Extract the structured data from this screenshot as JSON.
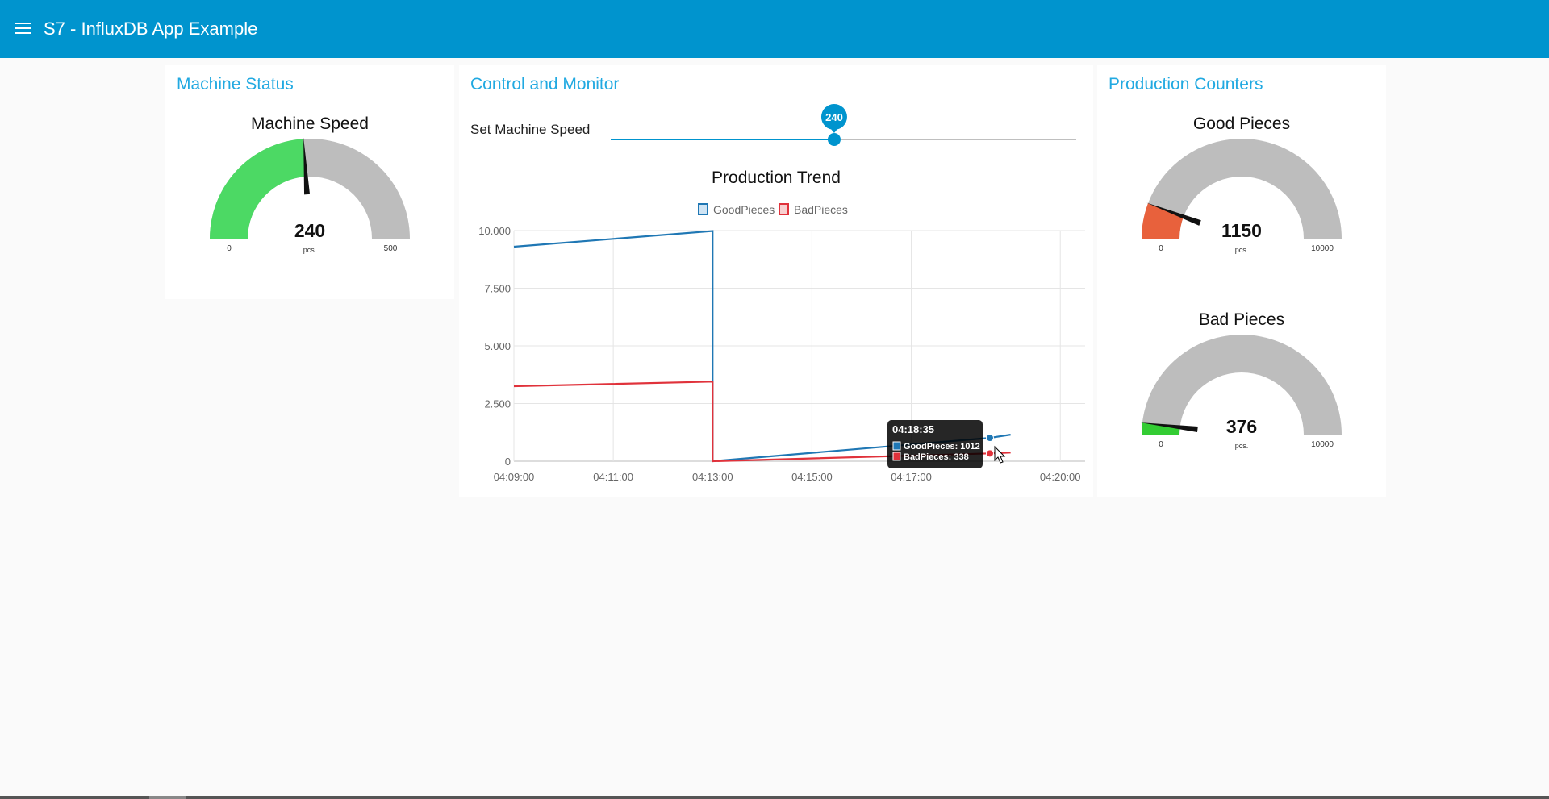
{
  "header": {
    "title": "S7 - InfluxDB App Example",
    "menu_icon": "hamburger-menu-icon"
  },
  "machine_status": {
    "title": "Machine Status",
    "gauge": {
      "title": "Machine Speed",
      "value": 240,
      "value_text": "240",
      "units": "pcs.",
      "min": 0,
      "max": 500,
      "min_label": "0",
      "max_label": "500",
      "color": "#4cd964"
    }
  },
  "control": {
    "title": "Control and Monitor",
    "slider": {
      "label": "Set Machine Speed",
      "value": 240,
      "value_text": "240",
      "min": 0,
      "max": 500,
      "color": "#0094ce"
    }
  },
  "chart_data": {
    "type": "line",
    "title": "Production Trend",
    "xlabel": "",
    "ylabel": "",
    "x_ticks": [
      "04:09:00",
      "04:11:00",
      "04:13:00",
      "04:15:00",
      "04:17:00",
      "04:20:00"
    ],
    "y_ticks": [
      "0",
      "2.500",
      "5.000",
      "7.500",
      "10.000"
    ],
    "ylim": [
      0,
      10000
    ],
    "xlim": [
      "04:09:00",
      "04:20:30"
    ],
    "grid": true,
    "legend_position": "top-center",
    "series": [
      {
        "name": "GoodPieces",
        "color": "#1f77b4",
        "points": [
          [
            "04:09:00",
            9300
          ],
          [
            "04:13:00",
            9980
          ],
          [
            "04:13:00",
            0
          ],
          [
            "04:18:35",
            1012
          ],
          [
            "04:19:00",
            1150
          ]
        ]
      },
      {
        "name": "BadPieces",
        "color": "#e0323b",
        "points": [
          [
            "04:09:00",
            3250
          ],
          [
            "04:13:00",
            3450
          ],
          [
            "04:13:00",
            0
          ],
          [
            "04:18:35",
            338
          ],
          [
            "04:19:00",
            376
          ]
        ]
      }
    ],
    "tooltip": {
      "time": "04:18:35",
      "rows": [
        "GoodPieces: 1012",
        "BadPieces: 338"
      ]
    }
  },
  "production": {
    "title": "Production Counters",
    "good": {
      "title": "Good Pieces",
      "value": 1150,
      "value_text": "1150",
      "units": "pcs.",
      "min": 0,
      "max": 10000,
      "min_label": "0",
      "max_label": "10000",
      "color": "#e8613c"
    },
    "bad": {
      "title": "Bad Pieces",
      "value": 376,
      "value_text": "376",
      "units": "pcs.",
      "min": 0,
      "max": 10000,
      "min_label": "0",
      "max_label": "10000",
      "color": "#33cc33"
    }
  }
}
